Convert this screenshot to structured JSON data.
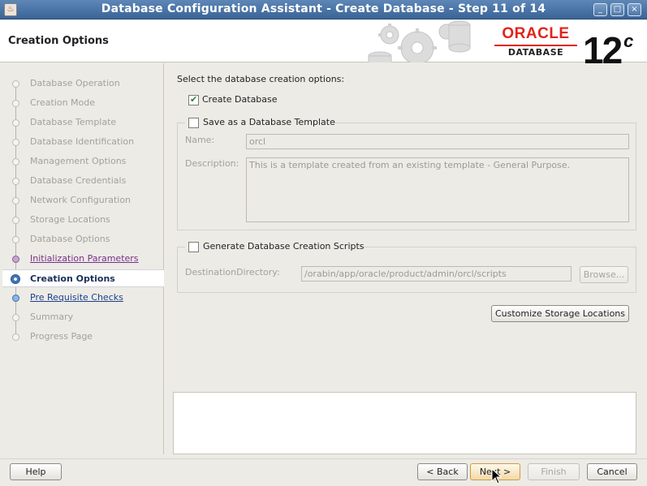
{
  "window": {
    "title": "Database Configuration Assistant - Create Database - Step 11 of 14",
    "controls": [
      "_",
      "□",
      "×"
    ]
  },
  "header": {
    "page_title": "Creation Options",
    "logo_word": "ORACLE",
    "logo_sub": "DATABASE",
    "version": "12",
    "version_sup": "c"
  },
  "sidebar": {
    "steps": [
      {
        "label": "Database Operation",
        "state": "done"
      },
      {
        "label": "Creation Mode",
        "state": "done"
      },
      {
        "label": "Database Template",
        "state": "done"
      },
      {
        "label": "Database Identification",
        "state": "done"
      },
      {
        "label": "Management Options",
        "state": "done"
      },
      {
        "label": "Database Credentials",
        "state": "done"
      },
      {
        "label": "Network Configuration",
        "state": "done"
      },
      {
        "label": "Storage Locations",
        "state": "done"
      },
      {
        "label": "Database Options",
        "state": "done"
      },
      {
        "label": "Initialization Parameters",
        "state": "visited"
      },
      {
        "label": "Creation Options",
        "state": "current"
      },
      {
        "label": "Pre Requisite Checks",
        "state": "link"
      },
      {
        "label": "Summary",
        "state": "pending"
      },
      {
        "label": "Progress Page",
        "state": "pending"
      }
    ]
  },
  "main": {
    "intro": "Select the database creation options:",
    "create_database": {
      "label": "Create Database",
      "checked": true
    },
    "save_template": {
      "label": "Save as a Database Template",
      "checked": false,
      "name_label": "Name:",
      "name_value": "orcl",
      "description_label": "Description:",
      "description_value": "This is a template created from an existing template - General Purpose."
    },
    "generate_scripts": {
      "label": "Generate Database Creation Scripts",
      "checked": false,
      "destination_label": "DestinationDirectory:",
      "destination_value": "/orabin/app/oracle/product/admin/orcl/scripts",
      "browse_label": "Browse..."
    },
    "customize_storage_label": "Customize Storage Locations"
  },
  "footer": {
    "help_label": "Help",
    "back_label": "< Back",
    "next_label": "Next >",
    "finish_label": "Finish",
    "cancel_label": "Cancel"
  }
}
